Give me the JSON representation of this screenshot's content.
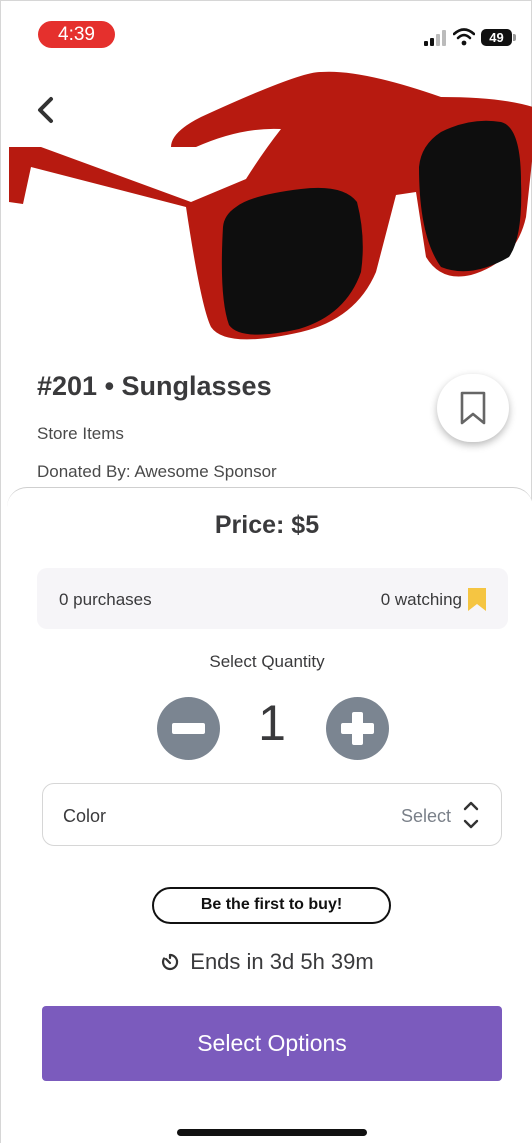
{
  "status_bar": {
    "time": "4:39",
    "battery": "49"
  },
  "item": {
    "title": "#201 • Sunglasses",
    "category": "Store Items",
    "donor": "Donated By: Awesome Sponsor"
  },
  "sheet": {
    "price": "Price: $5",
    "purchases": "0 purchases",
    "watching": "0 watching",
    "quantity_label": "Select Quantity",
    "quantity": "1",
    "color_label": "Color",
    "color_value": "Select",
    "first_buy": "Be the first to buy!",
    "ends": "Ends in 3d 5h 39m",
    "cta": "Select Options"
  },
  "colors": {
    "time_pill": "#e5302d",
    "accent": "#7b5bbd",
    "qty_buttons": "#7b8591",
    "watch_icon": "#f5c542",
    "frame_red": "#b71a10"
  },
  "icons": {
    "back": "chevron-left-icon",
    "bookmark": "bookmark-icon",
    "watching": "bookmark-filled-icon",
    "clock": "timer-icon",
    "minus": "minus-circle-icon",
    "plus": "plus-circle-icon"
  }
}
